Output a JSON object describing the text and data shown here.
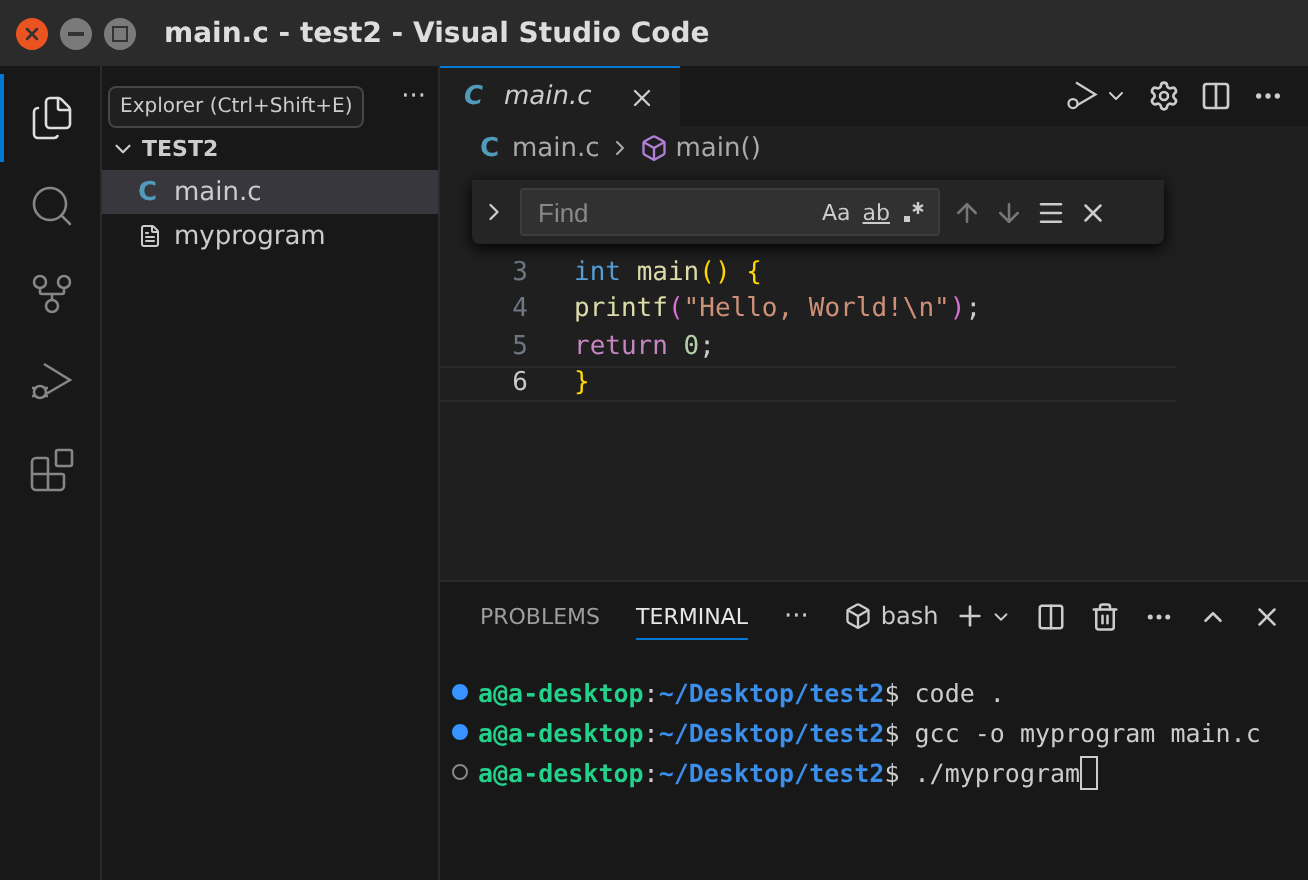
{
  "window": {
    "title": "main.c - test2 - Visual Studio Code"
  },
  "activity_bar": [
    {
      "kind": "explorer",
      "selected": true
    },
    {
      "kind": "search",
      "selected": false
    },
    {
      "kind": "source-control",
      "selected": false
    },
    {
      "kind": "run",
      "selected": false
    },
    {
      "kind": "extensions",
      "selected": false
    }
  ],
  "tooltip": "Explorer (Ctrl+Shift+E)",
  "sidebar": {
    "more": "···",
    "folder": "TEST2",
    "items": [
      {
        "kind": "c",
        "icon": "C",
        "label": "main.c",
        "selected": true
      },
      {
        "kind": "file",
        "label": "myprogram",
        "selected": false
      }
    ]
  },
  "editor": {
    "tabs": [
      {
        "kind": "c",
        "icon": "C",
        "label": "main.c",
        "selected": true
      }
    ],
    "breadcrumb": {
      "file_icon": "C",
      "file": "main.c",
      "symbol": "main()"
    },
    "find": {
      "placeholder": "Find",
      "options": [
        "Aa",
        "ab"
      ]
    },
    "lines": [
      {
        "number": "3",
        "current": false,
        "tokens": [
          {
            "text": "int ",
            "kind": "keyword"
          },
          {
            "text": "main",
            "kind": "function"
          },
          {
            "text": "()",
            "kind": "bracket"
          },
          {
            "text": "{",
            "kind": "bracket",
            "spaced": true
          }
        ]
      },
      {
        "number": "4",
        "current": false,
        "tokens": [
          {
            "text": "printf",
            "kind": "function"
          },
          {
            "text": "(",
            "kind": "bracket2"
          },
          {
            "text": "\"Hello, World!\\n\"",
            "kind": "string"
          },
          {
            "text": ")",
            "kind": "bracket2"
          },
          {
            "text": ";",
            "kind": "plain"
          }
        ]
      },
      {
        "number": "5",
        "current": false,
        "tokens": [
          {
            "text": "return ",
            "kind": "control"
          },
          {
            "text": "0",
            "kind": "number"
          },
          {
            "text": ";",
            "kind": "plain"
          }
        ]
      },
      {
        "number": "6",
        "current": true,
        "tokens": [
          {
            "text": "}",
            "kind": "bracket"
          }
        ]
      }
    ]
  },
  "panel": {
    "tabs": [
      {
        "label": "PROBLEMS",
        "selected": false
      },
      {
        "label": "TERMINAL",
        "selected": true
      }
    ],
    "more": "···",
    "shell": "bash",
    "terminal": [
      {
        "done": true,
        "user": "a@a-desktop",
        "sep": ":",
        "path": "~/Desktop/test2",
        "command": "$ code .",
        "cursor": false
      },
      {
        "done": true,
        "user": "a@a-desktop",
        "sep": ":",
        "path": "~/Desktop/test2",
        "command": "$ gcc -o myprogram main.c",
        "cursor": false
      },
      {
        "done": false,
        "user": "a@a-desktop",
        "sep": ":",
        "path": "~/Desktop/test2",
        "command": "$ ./myprogram",
        "cursor": true
      }
    ]
  }
}
